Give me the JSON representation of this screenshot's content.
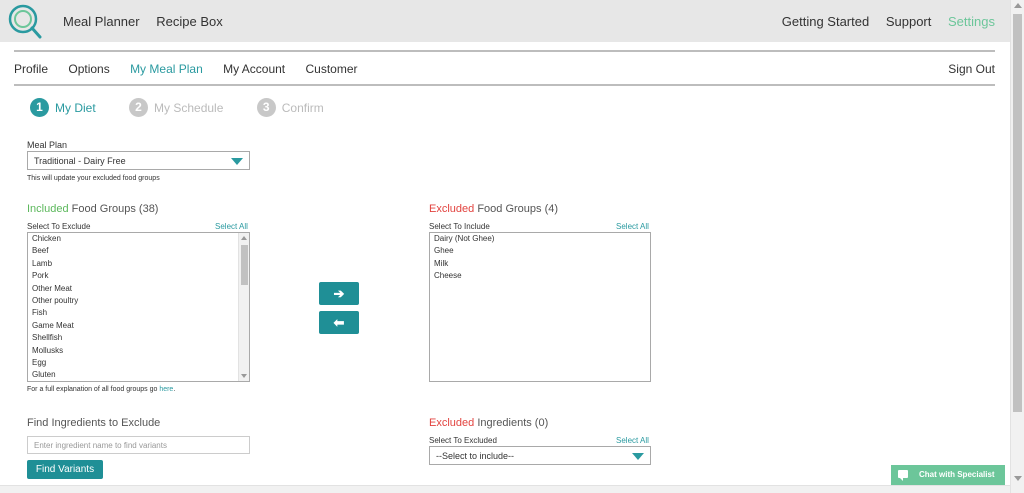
{
  "topbar": {
    "left_items": [
      "Meal Planner",
      "Recipe Box"
    ],
    "right_items": [
      {
        "label": "Getting Started",
        "active": false
      },
      {
        "label": "Support",
        "active": false
      },
      {
        "label": "Settings",
        "active": true
      }
    ]
  },
  "subnav": {
    "items": [
      {
        "label": "Profile",
        "active": false
      },
      {
        "label": "Options",
        "active": false
      },
      {
        "label": "My Meal Plan",
        "active": true
      },
      {
        "label": "My Account",
        "active": false
      },
      {
        "label": "Customer",
        "active": false
      }
    ],
    "signout": "Sign Out"
  },
  "steps": [
    {
      "num": "1",
      "label": "My Diet",
      "active": true
    },
    {
      "num": "2",
      "label": "My Schedule",
      "active": false
    },
    {
      "num": "3",
      "label": "Confirm",
      "active": false
    }
  ],
  "meal_plan": {
    "label": "Meal Plan",
    "value": "Traditional - Dairy Free",
    "note": "This will update your excluded food groups"
  },
  "included": {
    "title_colored": "Included",
    "title_rest": " Food Groups (38)",
    "sub_label": "Select To Exclude",
    "select_all": "Select All",
    "items": [
      "Chicken",
      "Beef",
      "Lamb",
      "Pork",
      "Other Meat",
      "Other poultry",
      "Fish",
      "Game Meat",
      "Shellfish",
      "Mollusks",
      "Egg",
      "Gluten"
    ]
  },
  "excluded": {
    "title_colored": "Excluded",
    "title_rest": " Food Groups (4)",
    "sub_label": "Select To Include",
    "select_all": "Select All",
    "items": [
      "Dairy (Not Ghee)",
      "Ghee",
      "Milk",
      "Cheese"
    ]
  },
  "explain": {
    "text": "For a full explanation of all food groups go ",
    "link": "here",
    "end": "."
  },
  "arrows": {
    "right": "➔",
    "left": "⬅"
  },
  "find": {
    "title": "Find Ingredients to Exclude",
    "placeholder": "Enter ingredient name to find variants",
    "button": "Find Variants"
  },
  "excluded_ingredients": {
    "title_colored": "Excluded",
    "title_rest": " Ingredients (0)",
    "sub_label": "Select To Excluded",
    "select_all": "Select All",
    "select_value": "--Select to include--"
  },
  "chat": {
    "label": "Chat with Specialist"
  },
  "colors": {
    "accent": "#2a9aa0",
    "green": "#5cb85c",
    "red": "#e2433f",
    "chat": "#6cc69a"
  }
}
